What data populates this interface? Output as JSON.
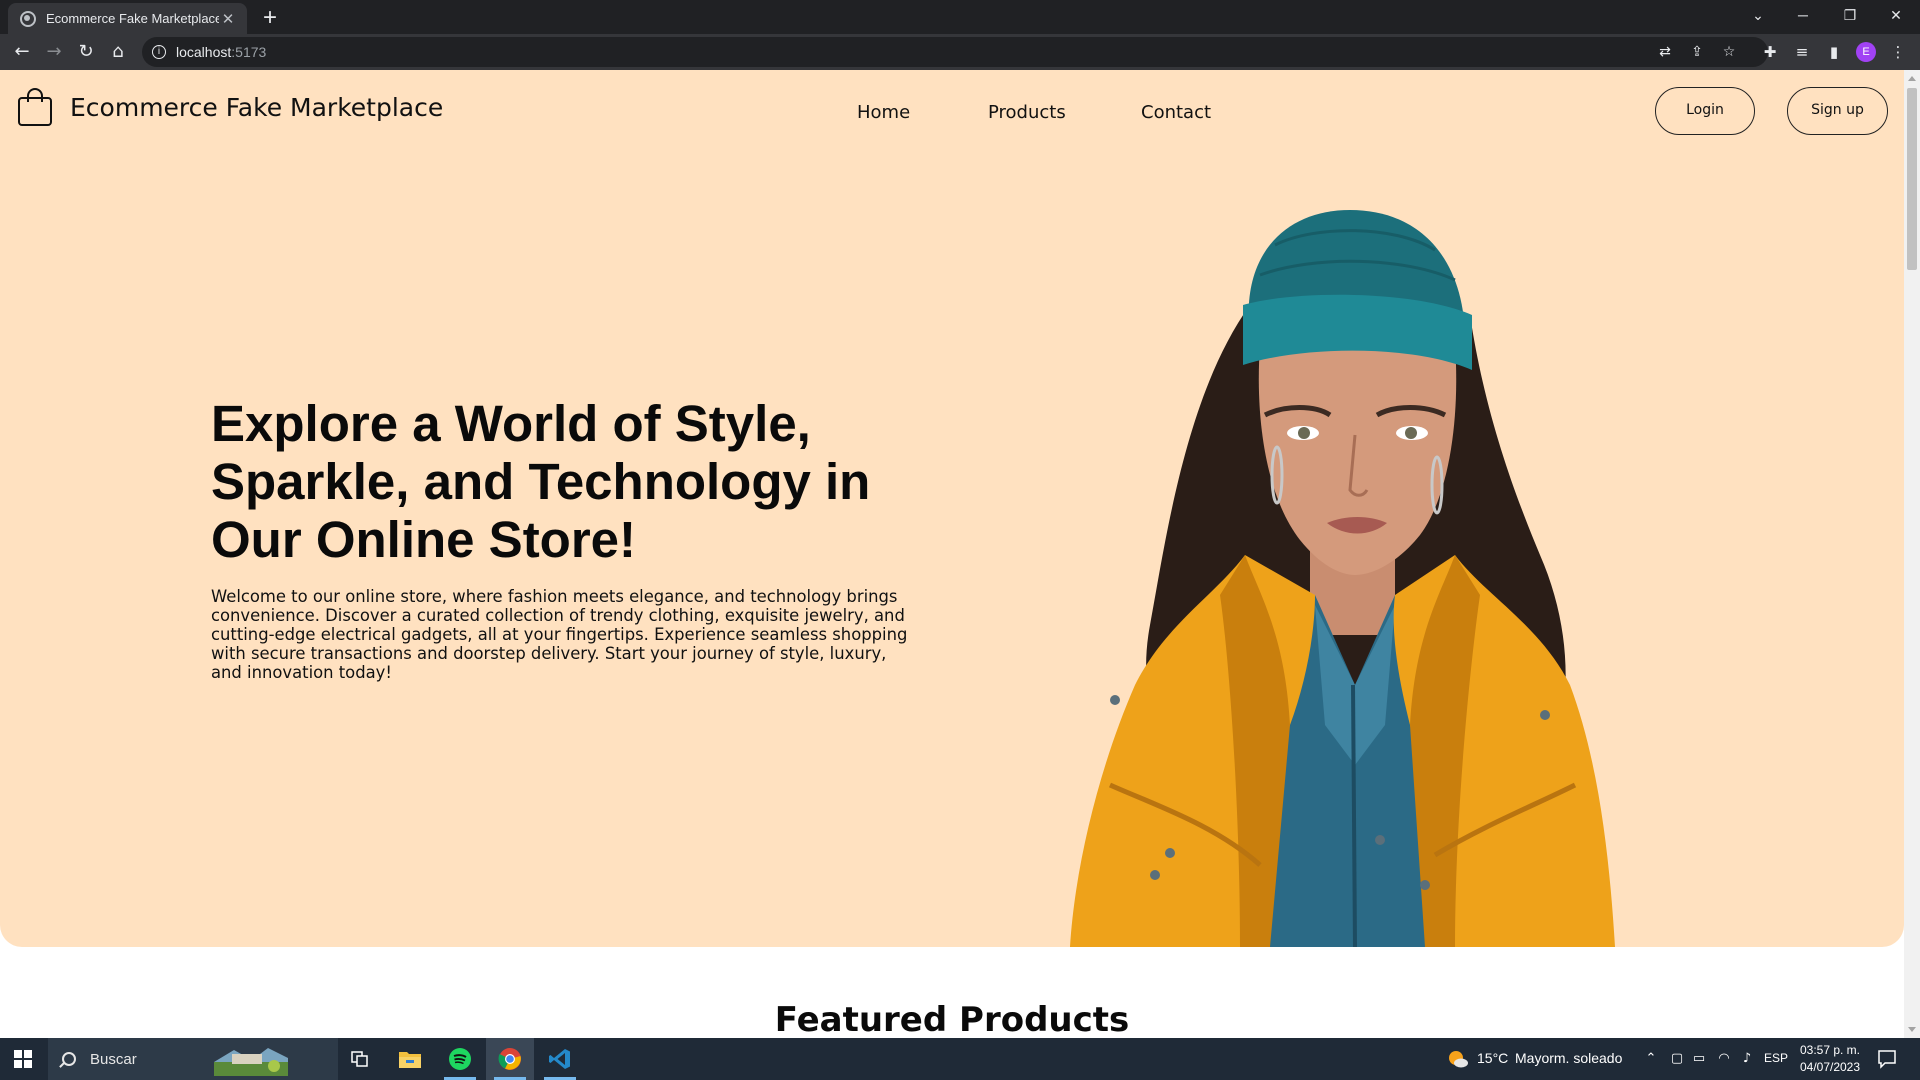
{
  "browser": {
    "tab_title": "Ecommerce Fake Marketplace",
    "tab_close": "✕",
    "new_tab": "+",
    "url_host": "localhost",
    "url_port": ":5173",
    "profile_initial": "E",
    "window_controls": {
      "minimize": "─",
      "restore": "❐",
      "close": "✕",
      "tab_search": "⌄"
    }
  },
  "site": {
    "brand": "Ecommerce Fake Marketplace",
    "nav": [
      "Home",
      "Products",
      "Contact"
    ],
    "login_label": "Login",
    "signup_label": "Sign up",
    "hero": {
      "headline_lines": [
        "Explore a World of Style,",
        "Sparkle, and Technology in",
        "Our Online Store!"
      ],
      "intro_lines": [
        "Welcome to our online store, where fashion meets elegance, and technology brings",
        "convenience. Discover a curated collection of trendy clothing, exquisite jewelry, and",
        "cutting-edge electrical gadgets, all at your fingertips. Experience seamless shopping",
        "with secure transactions and doorstep delivery. Start your journey of style, luxury,",
        "and innovation today!"
      ]
    },
    "featured_title": "Featured Products"
  },
  "taskbar": {
    "search_placeholder": "Buscar",
    "weather_temp": "15°C",
    "weather_text": "Mayorm. soleado",
    "language": "ESP",
    "time": "03:57 p. m.",
    "date": "04/07/2023"
  },
  "colors": {
    "hero_bg": "#ffe1c0",
    "jacket": "#eea21a",
    "beanie": "#1f8a96",
    "shirt": "#2b6a86"
  }
}
